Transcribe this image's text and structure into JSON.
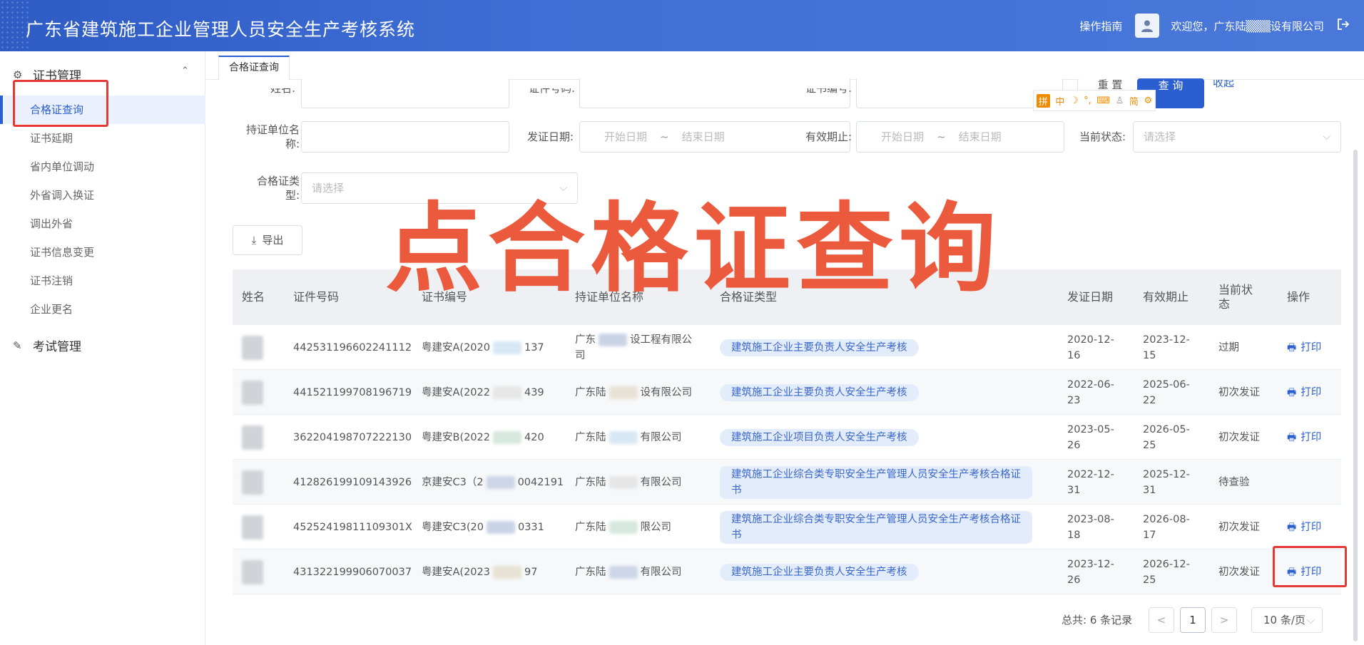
{
  "header": {
    "title": "广东省建筑施工企业管理人员安全生产考核系统",
    "guide": "操作指南",
    "welcome": "欢迎您，广东陆▒▒▒设有限公司"
  },
  "sidebar": {
    "cert_group": "证书管理",
    "exam_group": "考试管理",
    "items": [
      {
        "label": "合格证查询"
      },
      {
        "label": "证书延期"
      },
      {
        "label": "省内单位调动"
      },
      {
        "label": "外省调入换证"
      },
      {
        "label": "调出外省"
      },
      {
        "label": "证书信息变更"
      },
      {
        "label": "证书注销"
      },
      {
        "label": "企业更名"
      }
    ]
  },
  "tab": {
    "label": "合格证查询"
  },
  "form": {
    "name_label": "姓名:",
    "cert_no_label": "证件号码:",
    "cert_num_label": "证书编号:",
    "holder_unit_label": "持证单位名称:",
    "issue_date_label": "发证日期:",
    "valid_until_label": "有效期止:",
    "status_label": "当前状态:",
    "cert_type_label": "合格证类型:",
    "start_date_ph": "开始日期",
    "end_date_ph": "结束日期",
    "range_sep": "~",
    "select_ph": "请选择",
    "reset_btn": "重 置",
    "query_btn": "查 询",
    "collapse": "收起"
  },
  "export_btn": "导出",
  "overlay_text": "点合格证查询",
  "table": {
    "headers": [
      "姓名",
      "证件号码",
      "证书编号",
      "持证单位名称",
      "合格证类型",
      "发证日期",
      "有效期止",
      "当前状态",
      "操作"
    ],
    "rows": [
      {
        "id": "442531196602241112",
        "cert_a": "粤建安A(2020",
        "cert_b": "137",
        "unit_a": "广东",
        "unit_b": "设工程有限公",
        "unit_c": "司",
        "type": "建筑施工企业主要负责人安全生产考核",
        "issue_a": "2020-12-",
        "issue_b": "16",
        "valid_a": "2023-12-",
        "valid_b": "15",
        "status": "过期",
        "action": "打印"
      },
      {
        "id": "441521199708196719",
        "cert_a": "粤建安A(2022",
        "cert_b": "439",
        "unit_a": "广东陆",
        "unit_b": "设有限公司",
        "unit_c": "",
        "type": "建筑施工企业主要负责人安全生产考核",
        "issue_a": "2022-06-",
        "issue_b": "23",
        "valid_a": "2025-06-",
        "valid_b": "22",
        "status": "初次发证",
        "action": "打印"
      },
      {
        "id": "362204198707222130",
        "cert_a": "粤建安B(2022",
        "cert_b": "420",
        "unit_a": "广东陆",
        "unit_b": "有限公司",
        "unit_c": "",
        "type": "建筑施工企业项目负责人安全生产考核",
        "issue_a": "2023-05-",
        "issue_b": "26",
        "valid_a": "2026-05-",
        "valid_b": "25",
        "status": "初次发证",
        "action": "打印"
      },
      {
        "id": "412826199109143926",
        "cert_a": "京建安C3（2",
        "cert_b": "0042191",
        "unit_a": "广东陆",
        "unit_b": "有限公司",
        "unit_c": "",
        "type_a": "建筑施工企业综合类专职安全生产管理人员安全生产考核合格证",
        "type_b": "书",
        "issue_a": "2022-12-",
        "issue_b": "31",
        "valid_a": "2025-12-",
        "valid_b": "31",
        "status": "待查验",
        "action": ""
      },
      {
        "id": "45252419811109301X",
        "cert_a": "粤建安C3(20",
        "cert_b": "0331",
        "unit_a": "广东陆",
        "unit_b": "限公司",
        "unit_c": "",
        "type_a": "建筑施工企业综合类专职安全生产管理人员安全生产考核合格证",
        "type_b": "书",
        "issue_a": "2023-08-",
        "issue_b": "18",
        "valid_a": "2026-08-",
        "valid_b": "17",
        "status": "初次发证",
        "action": "打印"
      },
      {
        "id": "431322199906070037",
        "cert_a": "粤建安A(2023",
        "cert_b": "97",
        "unit_a": "广东陆",
        "unit_b": "有限公司",
        "unit_c": "",
        "type": "建筑施工企业主要负责人安全生产考核",
        "issue_a": "2023-12-",
        "issue_b": "26",
        "valid_a": "2026-12-",
        "valid_b": "25",
        "status": "初次发证",
        "action": "打印"
      }
    ]
  },
  "pager": {
    "total": "总共:  6 条记录",
    "prev": "<",
    "page": "1",
    "next": ">",
    "size": "10 条/页"
  },
  "ime": {
    "a": "拼",
    "b": "中",
    "c": "简"
  },
  "colors": {
    "accent": "#2b5fd0",
    "header": "#3a66cf",
    "overlay": "#ec5a3d",
    "highlight": "#e53935"
  }
}
